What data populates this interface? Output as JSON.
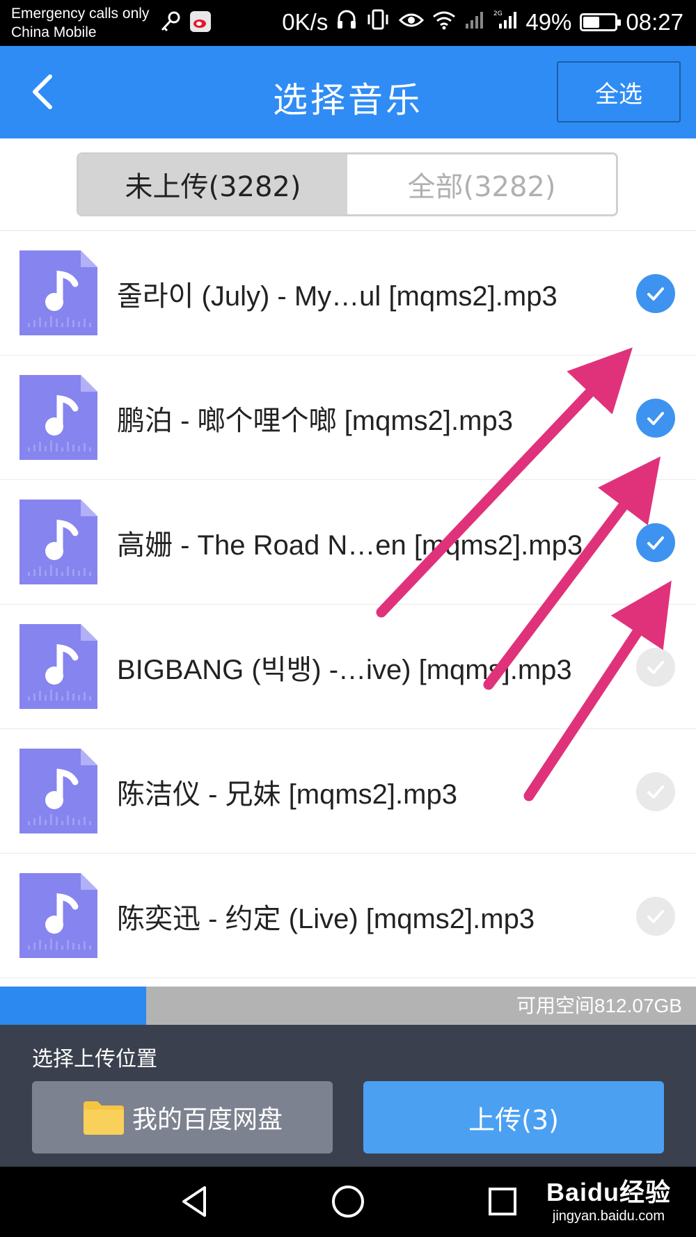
{
  "status_bar": {
    "carrier_line1": "Emergency calls only",
    "carrier_line2": "China Mobile",
    "net_speed": "0K/s",
    "battery_percent": "49%",
    "battery_level": 0.49,
    "time": "08:27",
    "icons": [
      "key-icon",
      "weibo-icon",
      "headset-icon",
      "vibrate-icon",
      "eye-icon",
      "wifi-icon",
      "signal-icon",
      "4g-signal-icon",
      "battery-icon"
    ]
  },
  "header": {
    "title": "选择音乐",
    "select_all_label": "全选",
    "back_icon": "chevron-left-icon"
  },
  "tabs": [
    {
      "label": "未上传(3282)",
      "active": true
    },
    {
      "label": "全部(3282)",
      "active": false
    }
  ],
  "files": [
    {
      "name": "줄라이 (July) - My…ul [mqms2].mp3",
      "checked": true
    },
    {
      "name": "鹏泊 - 啷个哩个啷 [mqms2].mp3",
      "checked": true
    },
    {
      "name": "高姗 - The Road N…en [mqms2].mp3",
      "checked": true
    },
    {
      "name": "BIGBANG (빅뱅) -…ive) [mqms].mp3",
      "checked": false
    },
    {
      "name": "陈洁仪 - 兄妹 [mqms2].mp3",
      "checked": false
    },
    {
      "name": "陈奕迅 - 约定 (Live) [mqms2].mp3",
      "checked": false
    }
  ],
  "storage": {
    "available_text": "可用空间812.07GB",
    "used_fraction": 0.21,
    "fill_color": "#2b89ef"
  },
  "bottom": {
    "location_label": "选择上传位置",
    "location_button": "我的百度网盘",
    "upload_button": "上传(3)"
  },
  "nav": {
    "icons": [
      "back-triangle-icon",
      "home-circle-icon",
      "recents-square-icon"
    ]
  },
  "watermark": {
    "brand": "Baidu经验",
    "domain": "jingyan.baidu.com"
  },
  "colors": {
    "header_blue": "#2f8cf5",
    "check_blue": "#3d93ef",
    "file_icon_purple": "#8684ee",
    "arrow_pink": "#e0327a",
    "panel_dark": "#3a404d"
  }
}
